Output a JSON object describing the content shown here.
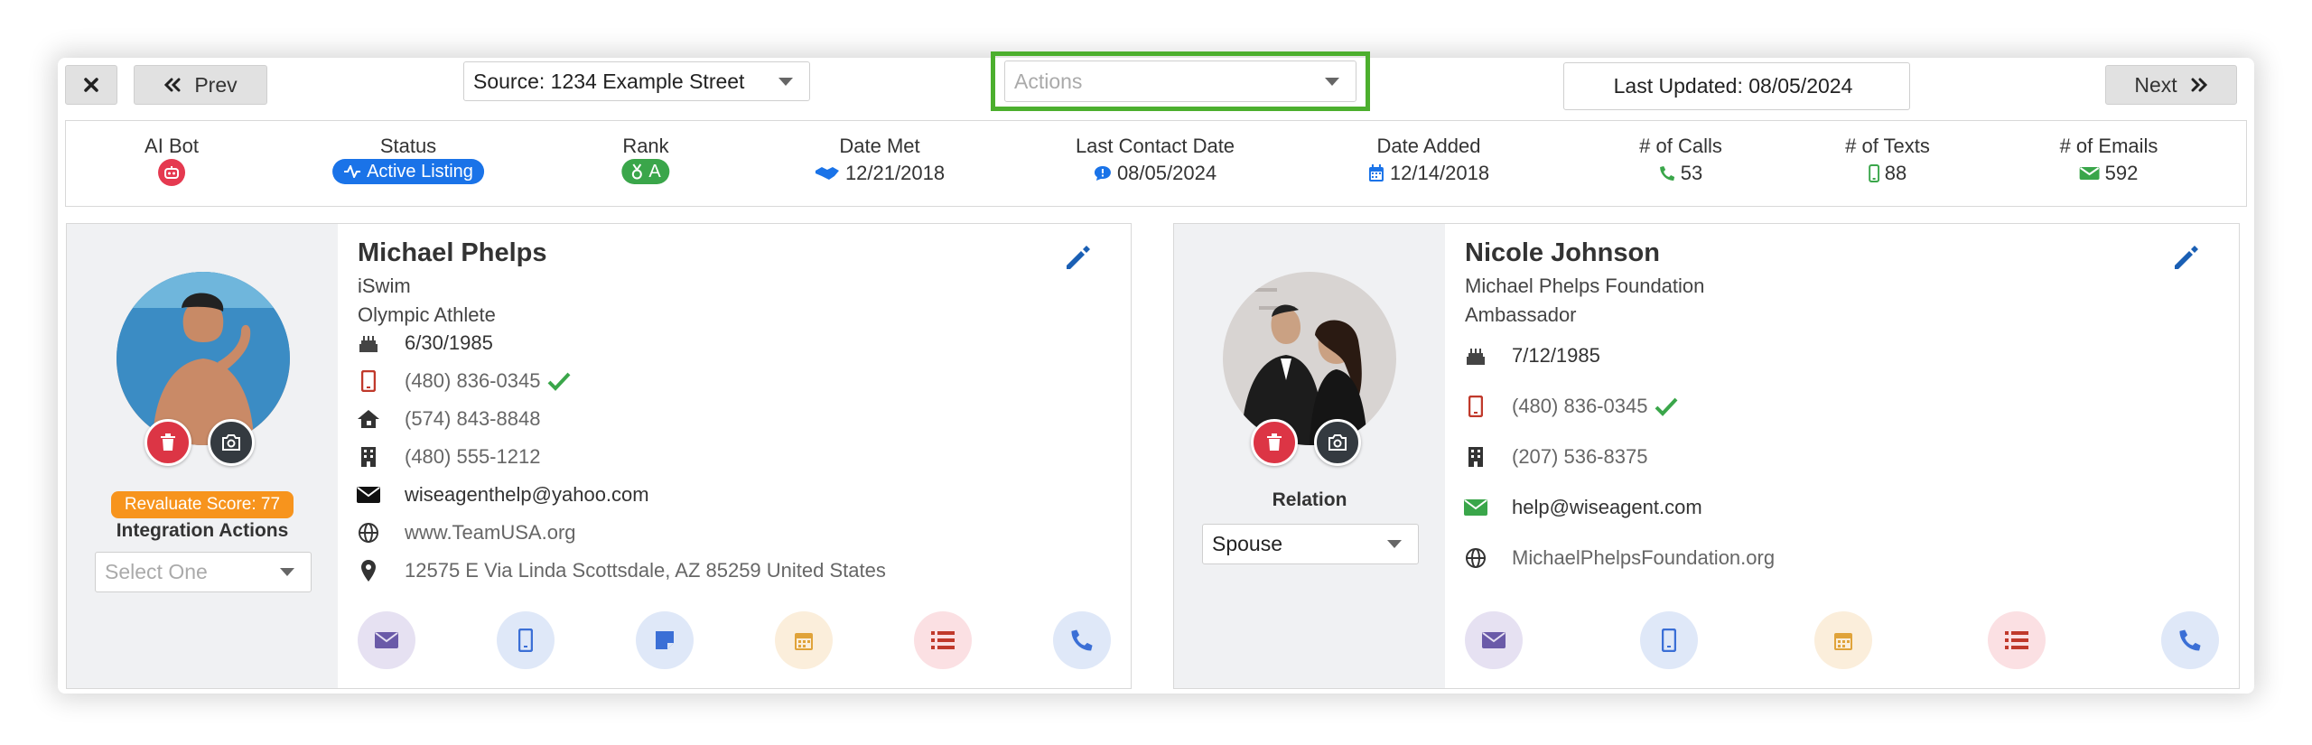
{
  "topbar": {
    "close_icon": "close-icon",
    "prev_label": "Prev",
    "source_value": "Source: 1234 Example Street",
    "actions_placeholder": "Actions",
    "last_updated": "Last Updated: 08/05/2024",
    "next_label": "Next",
    "highlight_color": "#4caf2e"
  },
  "stats": {
    "ai_bot": {
      "label": "AI Bot",
      "icon": "robot-icon"
    },
    "status": {
      "label": "Status",
      "value": "Active Listing",
      "color": "#1a73e8"
    },
    "rank": {
      "label": "Rank",
      "value": "A",
      "color": "#3aa64a"
    },
    "date_met": {
      "label": "Date Met",
      "value": "12/21/2018"
    },
    "last_contact": {
      "label": "Last Contact Date",
      "value": "08/05/2024"
    },
    "date_added": {
      "label": "Date Added",
      "value": "12/14/2018"
    },
    "calls": {
      "label": "# of Calls",
      "value": "53"
    },
    "texts": {
      "label": "# of Texts",
      "value": "88"
    },
    "emails": {
      "label": "# of Emails",
      "value": "592"
    }
  },
  "contact1": {
    "name": "Michael Phelps",
    "company": "iSwim",
    "title": "Olympic Athlete",
    "birthday": "6/30/1985",
    "mobile": "(480) 836-0345",
    "home": "(574) 843-8848",
    "office": "(480) 555-1212",
    "email": "wiseagenthelp@yahoo.com",
    "website": "www.TeamUSA.org",
    "address": "12575 E Via Linda Scottsdale, AZ 85259 United States",
    "revaluate": "Revaluate Score: 77",
    "integration_label": "Integration Actions",
    "integration_placeholder": "Select One"
  },
  "contact2": {
    "name": "Nicole Johnson",
    "company": "Michael Phelps Foundation",
    "title": "Ambassador",
    "birthday": "7/12/1985",
    "mobile": "(480) 836-0345",
    "office": "(207) 536-8375",
    "email": "help@wiseagent.com",
    "website": "MichaelPhelpsFoundation.org",
    "relation_label": "Relation",
    "relation_value": "Spouse"
  }
}
